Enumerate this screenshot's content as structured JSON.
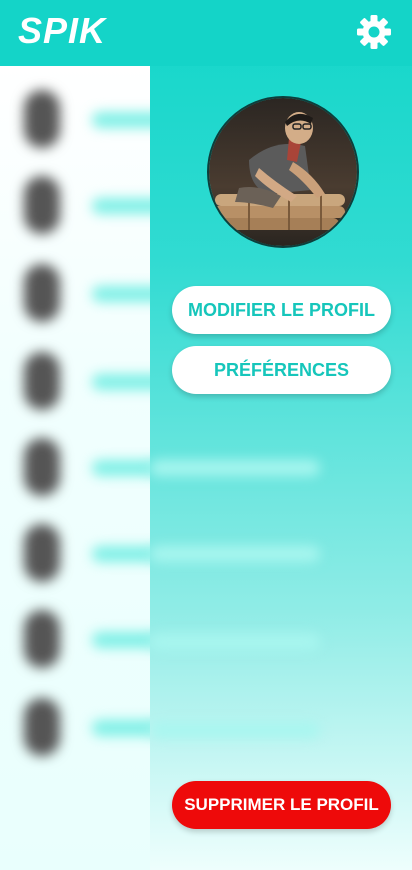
{
  "header": {
    "brand": "SPIK",
    "settings_icon": "gear-icon"
  },
  "profile": {
    "photo": "profile-photo"
  },
  "actions": {
    "edit_profile": "MODIFIER LE PROFIL",
    "preferences": "PRÉFÉRENCES",
    "delete_profile": "SUPPRIMER LE PROFIL"
  },
  "colors": {
    "accent": "#14d4c8",
    "danger": "#ee0a0a",
    "button_text": "#16c6bb"
  }
}
